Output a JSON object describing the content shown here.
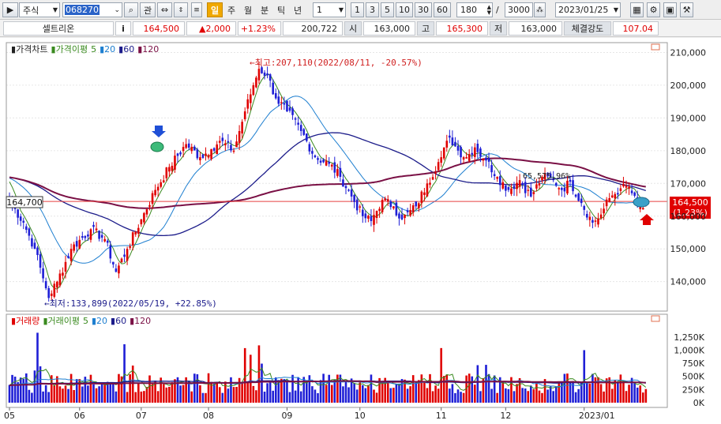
{
  "toolbar": {
    "market": "주식",
    "code": "068270",
    "btn_watch": "관",
    "period_active": "일",
    "periods": [
      "주",
      "월",
      "분",
      "틱",
      "년"
    ],
    "multiplier": "1",
    "n_buttons": [
      "1",
      "3",
      "5",
      "10",
      "30",
      "60"
    ],
    "count": "180",
    "slash": "/",
    "total": "3000",
    "date": "2023/01/25"
  },
  "quote": {
    "name": "셀트리온",
    "info": "i",
    "price": "164,500",
    "change": "▲2,000",
    "change_pct": "+1.23%",
    "volume": "200,722",
    "open_label": "시",
    "open": "163,000",
    "high_label": "고",
    "high": "165,300",
    "low_label": "저",
    "low": "163,000",
    "strength_label": "체결강도",
    "strength": "107.04"
  },
  "legend_price": {
    "title": "가격차트",
    "ma_title": "가격이평",
    "ma": [
      "5",
      "20",
      "60",
      "120"
    ]
  },
  "legend_volume": {
    "title": "거래량",
    "ma_title": "거래이평",
    "ma": [
      "5",
      "20",
      "60",
      "120"
    ]
  },
  "annotations": {
    "high": "←최고:207,110(2022/08/11, -20.57%)",
    "low": "←최저:133,899(2022/05/19, +22.85%)",
    "left_price": "164,700",
    "right_price": "164,500",
    "right_pct": "(1.23%)",
    "mid_text": "65,575,96%"
  },
  "colors": {
    "up": "#e00000",
    "down": "#1f1fd6",
    "ma5": "#3a8a1f",
    "ma20": "#1e7fd0",
    "ma60": "#1c1c8a",
    "ma120": "#7a1045",
    "price_line": "#e84040",
    "accent": "#f0a800"
  },
  "chart_data": {
    "type": "candlestick",
    "x_ticks": [
      "05",
      "06",
      "07",
      "08",
      "09",
      "10",
      "11",
      "12",
      "2023/01"
    ],
    "y_ticks": [
      "210,000",
      "200,000",
      "190,000",
      "180,000",
      "170,000",
      "160,000",
      "150,000",
      "140,000"
    ],
    "y_tick_values": [
      210000,
      200000,
      190000,
      180000,
      170000,
      160000,
      150000,
      140000
    ],
    "ylim": [
      131000,
      213000
    ],
    "vol_ticks": [
      "1,250K",
      "1,000K",
      "750K",
      "500K",
      "250K",
      "0K"
    ],
    "vol_tick_values": [
      1250000,
      1000000,
      750000,
      500000,
      250000,
      0
    ],
    "vol_ylim": [
      0,
      1400000
    ],
    "high": {
      "value": 207110,
      "date": "2022/08/11",
      "pct": -20.57
    },
    "low": {
      "value": 133899,
      "date": "2022/05/19",
      "pct": 22.85
    },
    "last_close": 164500,
    "prev_close": 162500,
    "key_closes": [
      {
        "i": 0,
        "c": 164700
      },
      {
        "i": 5,
        "c": 158000
      },
      {
        "i": 9,
        "c": 150000
      },
      {
        "i": 12,
        "c": 141000
      },
      {
        "i": 14,
        "c": 135500
      },
      {
        "i": 17,
        "c": 140000
      },
      {
        "i": 22,
        "c": 150000
      },
      {
        "i": 29,
        "c": 156000
      },
      {
        "i": 34,
        "c": 153000
      },
      {
        "i": 38,
        "c": 143000
      },
      {
        "i": 42,
        "c": 150000
      },
      {
        "i": 47,
        "c": 159000
      },
      {
        "i": 52,
        "c": 168000
      },
      {
        "i": 57,
        "c": 175000
      },
      {
        "i": 63,
        "c": 182000
      },
      {
        "i": 68,
        "c": 178000
      },
      {
        "i": 72,
        "c": 180500
      },
      {
        "i": 75,
        "c": 183000
      },
      {
        "i": 80,
        "c": 180000
      },
      {
        "i": 84,
        "c": 192000
      },
      {
        "i": 87,
        "c": 200000
      },
      {
        "i": 89,
        "c": 205000
      },
      {
        "i": 92,
        "c": 203000
      },
      {
        "i": 95,
        "c": 196000
      },
      {
        "i": 99,
        "c": 192000
      },
      {
        "i": 104,
        "c": 186000
      },
      {
        "i": 109,
        "c": 178000
      },
      {
        "i": 114,
        "c": 176000
      },
      {
        "i": 118,
        "c": 172000
      },
      {
        "i": 122,
        "c": 166000
      },
      {
        "i": 126,
        "c": 160000
      },
      {
        "i": 129,
        "c": 158500
      },
      {
        "i": 133,
        "c": 165000
      },
      {
        "i": 137,
        "c": 163000
      },
      {
        "i": 140,
        "c": 159000
      },
      {
        "i": 145,
        "c": 163000
      },
      {
        "i": 149,
        "c": 170000
      },
      {
        "i": 154,
        "c": 178000
      },
      {
        "i": 157,
        "c": 184000
      },
      {
        "i": 160,
        "c": 180000
      },
      {
        "i": 163,
        "c": 178000
      },
      {
        "i": 166,
        "c": 181000
      },
      {
        "i": 170,
        "c": 177000
      },
      {
        "i": 174,
        "c": 172000
      },
      {
        "i": 178,
        "c": 168000
      },
      {
        "i": 182,
        "c": 171000
      },
      {
        "i": 186,
        "c": 166000
      },
      {
        "i": 190,
        "c": 172000
      },
      {
        "i": 194,
        "c": 171000
      },
      {
        "i": 197,
        "c": 168000
      },
      {
        "i": 200,
        "c": 170500
      },
      {
        "i": 204,
        "c": 164000
      },
      {
        "i": 208,
        "c": 158000
      },
      {
        "i": 211,
        "c": 160500
      },
      {
        "i": 214,
        "c": 165500
      },
      {
        "i": 218,
        "c": 168500
      },
      {
        "i": 221,
        "c": 169000
      },
      {
        "i": 224,
        "c": 163000
      },
      {
        "i": 226,
        "c": 162500
      },
      {
        "i": 227,
        "c": 164500
      }
    ]
  }
}
